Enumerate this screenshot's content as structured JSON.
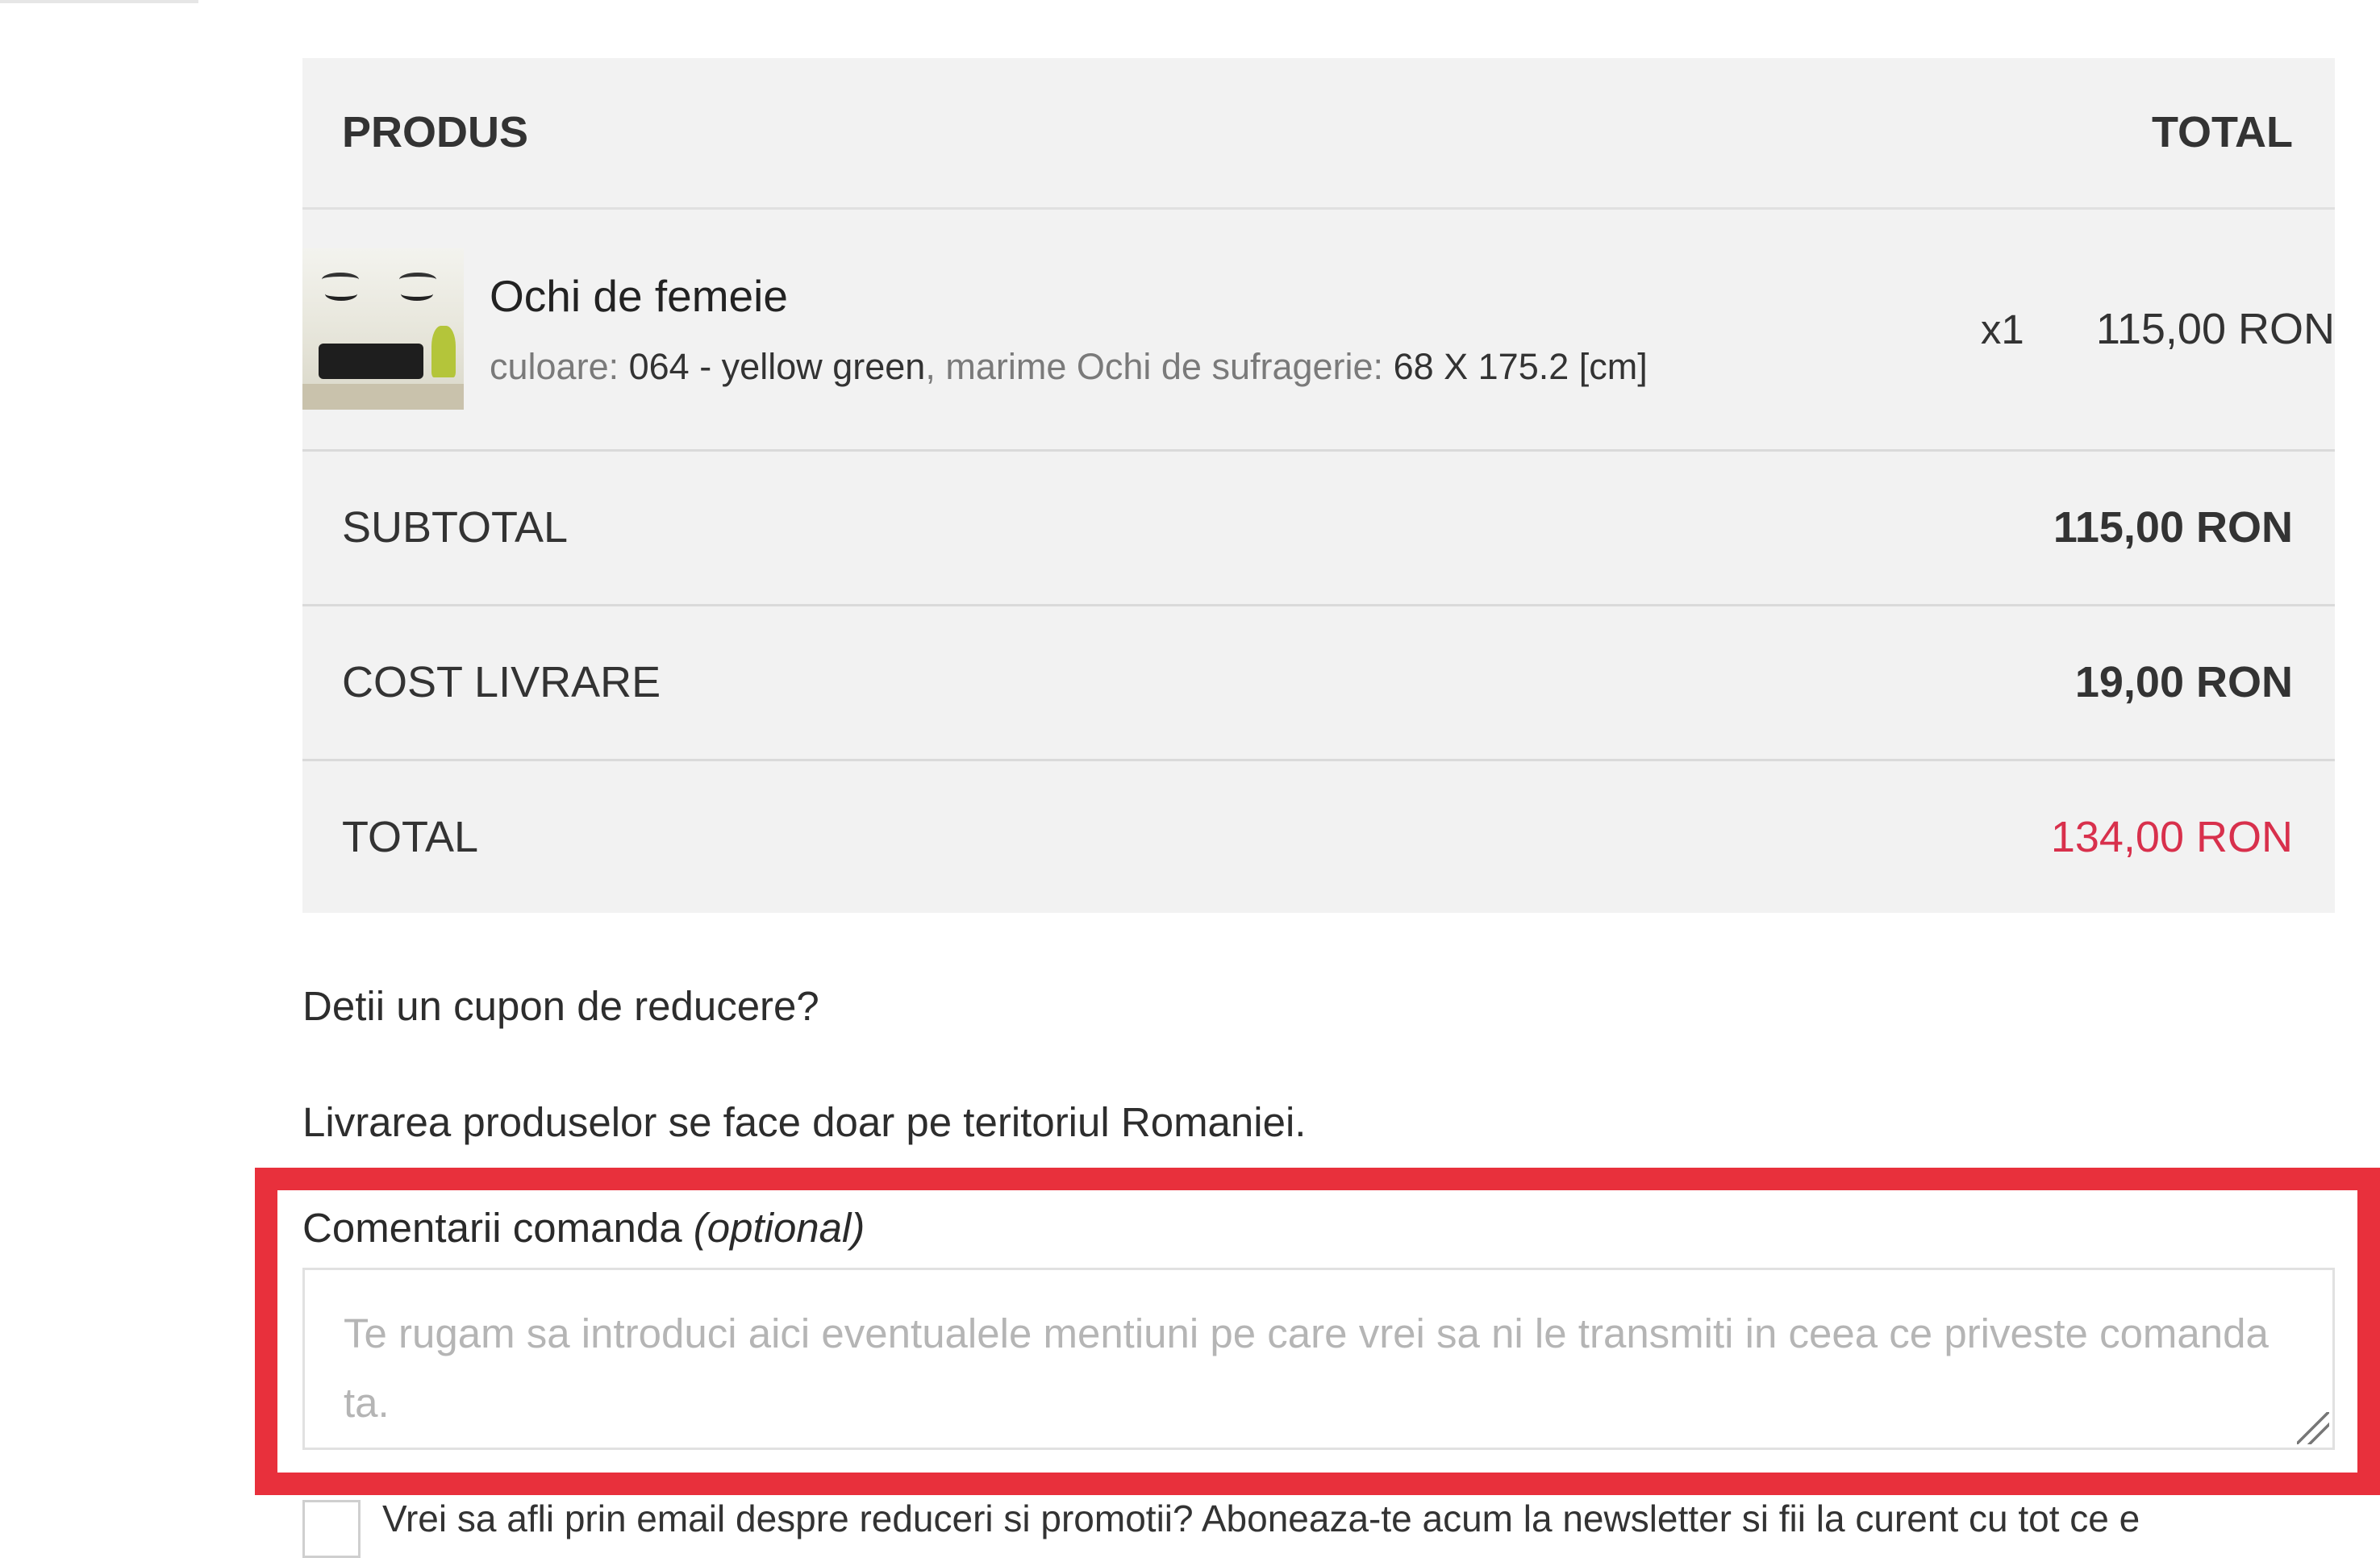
{
  "table": {
    "header": {
      "product": "PRODUS",
      "total": "TOTAL"
    },
    "product": {
      "name": "Ochi de femeie",
      "attr1_label": "culoare:",
      "attr1_value": "064 - yellow green",
      "sep": ",",
      "attr2_label": "marime Ochi de sufragerie:",
      "attr2_value": "68 X 175.2 [cm]",
      "qty": "x1",
      "price": "115,00 RON"
    },
    "subtotal": {
      "label": "SUBTOTAL",
      "value": "115,00 RON"
    },
    "shipping": {
      "label": "COST LIVRARE",
      "value": "19,00 RON"
    },
    "total": {
      "label": "TOTAL",
      "value": "134,00 RON"
    }
  },
  "coupon_text": "Detii un cupon de reducere?",
  "delivery_note": "Livrarea produselor se face doar pe teritoriul Romaniei.",
  "comments": {
    "label": "Comentarii comanda",
    "optional": "(optional)",
    "placeholder": "Te rugam sa introduci aici eventualele mentiuni pe care vrei sa ni le transmiti in ceea ce priveste comanda ta."
  },
  "newsletter": {
    "text": "Vrei sa afli prin email despre reduceri si promotii? Aboneaza-te acum la newsletter si fii la curent cu tot ce e"
  },
  "colors": {
    "total_accent": "#d8304c",
    "highlight_border": "#e8303c",
    "table_bg": "#f2f2f2"
  },
  "icons": {
    "textarea_resize": "resize-grip-icon"
  }
}
